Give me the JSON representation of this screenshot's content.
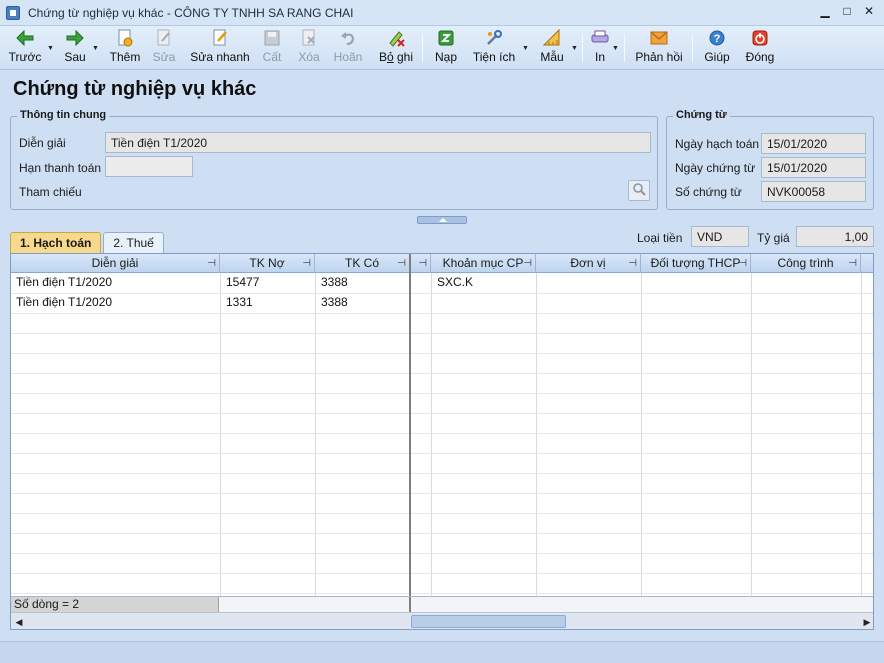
{
  "window": {
    "title": "Chứng từ nghiệp vụ khác - CÔNG TY TNHH SA RANG CHAI",
    "minimize": "▁",
    "maximize": "□",
    "close": "✕"
  },
  "toolbar": {
    "prev": "Trước",
    "next": "Sau",
    "add": "Thêm",
    "edit": "Sửa",
    "quick_edit": "Sửa nhanh",
    "save": "Cất",
    "delete": "Xóa",
    "undo": "Hoãn",
    "unpost_pre": "B",
    "unpost_u": "ỏ",
    "unpost_post": " ghi",
    "load": "Nạp",
    "utilities": "Tiện ích",
    "template": "Mẫu",
    "print": "In",
    "feedback": "Phản hồi",
    "help": "Giúp",
    "close": "Đóng"
  },
  "page_title": "Chứng từ nghiệp vụ khác",
  "general_info": {
    "title": "Thông tin chung",
    "description_label": "Diễn giải",
    "description_value": "Tiền điện T1/2020",
    "due_date_label": "Hạn thanh toán",
    "due_date_value": "",
    "reference_label": "Tham chiếu"
  },
  "voucher": {
    "title": "Chứng từ",
    "posting_date_label": "Ngày hạch toán",
    "posting_date_value": "15/01/2020",
    "voucher_date_label": "Ngày chứng từ",
    "voucher_date_value": "15/01/2020",
    "voucher_no_label": "Số chứng từ",
    "voucher_no_value": "NVK00058"
  },
  "currency": {
    "label": "Loại tiền",
    "value": "VND",
    "rate_label": "Tỷ giá",
    "rate_value": "1,00"
  },
  "tabs": {
    "accounting": "1. Hạch toán",
    "tax": "2. Thuế"
  },
  "grid": {
    "columns": [
      "Diễn giải",
      "TK Nợ",
      "TK Có",
      "",
      "Khoản mục CP",
      "Đơn vị",
      "Đối tượng THCP",
      "Công trình"
    ],
    "rows": [
      {
        "desc": "Tiền điện T1/2020",
        "debit": "15477",
        "credit": "3388",
        "cost_item": "SXC.K"
      },
      {
        "desc": "Tiền điện T1/2020",
        "debit": "1331",
        "credit": "3388",
        "cost_item": ""
      }
    ],
    "row_count": "Số dòng = 2"
  }
}
